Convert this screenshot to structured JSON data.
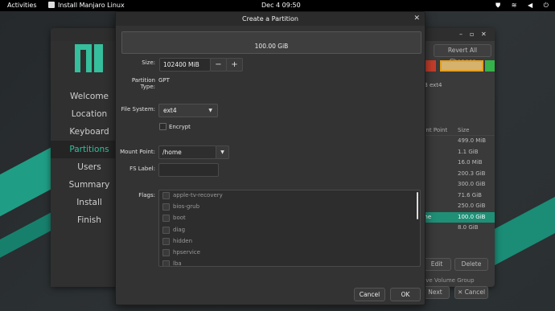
{
  "topbar": {
    "activities": "Activities",
    "app_name": "Install Manjaro Linux",
    "clock": "Dec 4  09:50",
    "tray_icons": [
      "shield-icon",
      "wifi-icon",
      "volume-icon",
      "power-icon"
    ],
    "tray_glyphs": [
      "⛊",
      "≋",
      "◀",
      "⏻"
    ]
  },
  "installer": {
    "window_controls": [
      "–",
      "▫",
      "✕"
    ],
    "sidebar": {
      "items": [
        {
          "label": "Welcome",
          "active": false
        },
        {
          "label": "Location",
          "active": false
        },
        {
          "label": "Keyboard",
          "active": false
        },
        {
          "label": "Partitions",
          "active": true
        },
        {
          "label": "Users",
          "active": false
        },
        {
          "label": "Summary",
          "active": false
        },
        {
          "label": "Install",
          "active": false
        },
        {
          "label": "Finish",
          "active": false
        }
      ]
    },
    "right": {
      "revert_label": "Revert All Changes",
      "partition_label": "iB  ext4",
      "list_headers": [
        "unt Point",
        "Size"
      ],
      "rows": [
        {
          "mount": "",
          "size": "499.0 MiB",
          "selected": false
        },
        {
          "mount": "",
          "size": "1.1 GiB",
          "selected": false
        },
        {
          "mount": "",
          "size": "16.0 MiB",
          "selected": false
        },
        {
          "mount": "",
          "size": "200.3 GiB",
          "selected": false
        },
        {
          "mount": "",
          "size": "300.0 GiB",
          "selected": false
        },
        {
          "mount": "",
          "size": "71.6 GiB",
          "selected": false
        },
        {
          "mount": "",
          "size": "250.0 GiB",
          "selected": false
        },
        {
          "mount": "me",
          "size": "100.0 GiB",
          "selected": true
        },
        {
          "mount": "",
          "size": "8.0 GiB",
          "selected": false
        }
      ],
      "edit_label": "Edit",
      "delete_label": "Delete",
      "volume_group_label": "ove Volume Group",
      "next_label": "Next",
      "cancel_label": "✕ Cancel"
    }
  },
  "dialog": {
    "title": "Create a Partition",
    "close_glyph": "✕",
    "size_bar_label": "100.00 GiB",
    "size_label": "Size:",
    "size_value": "102400 MiB",
    "minus": "−",
    "plus": "+",
    "partition_type_label": "Partition Type:",
    "partition_type_value": "GPT",
    "file_system_label": "File System:",
    "file_system_value": "ext4",
    "encrypt_label": "Encrypt",
    "mount_point_label": "Mount Point:",
    "mount_point_value": "/home",
    "fs_label_label": "FS Label:",
    "fs_label_value": "",
    "flags_label": "Flags:",
    "flags": [
      "apple-tv-recovery",
      "bios-grub",
      "boot",
      "diag",
      "hidden",
      "hpservice",
      "lba"
    ],
    "cancel_label": "Cancel",
    "ok_label": "OK"
  },
  "colors": {
    "accent": "#35bf9c",
    "selection": "#1f8f76"
  }
}
